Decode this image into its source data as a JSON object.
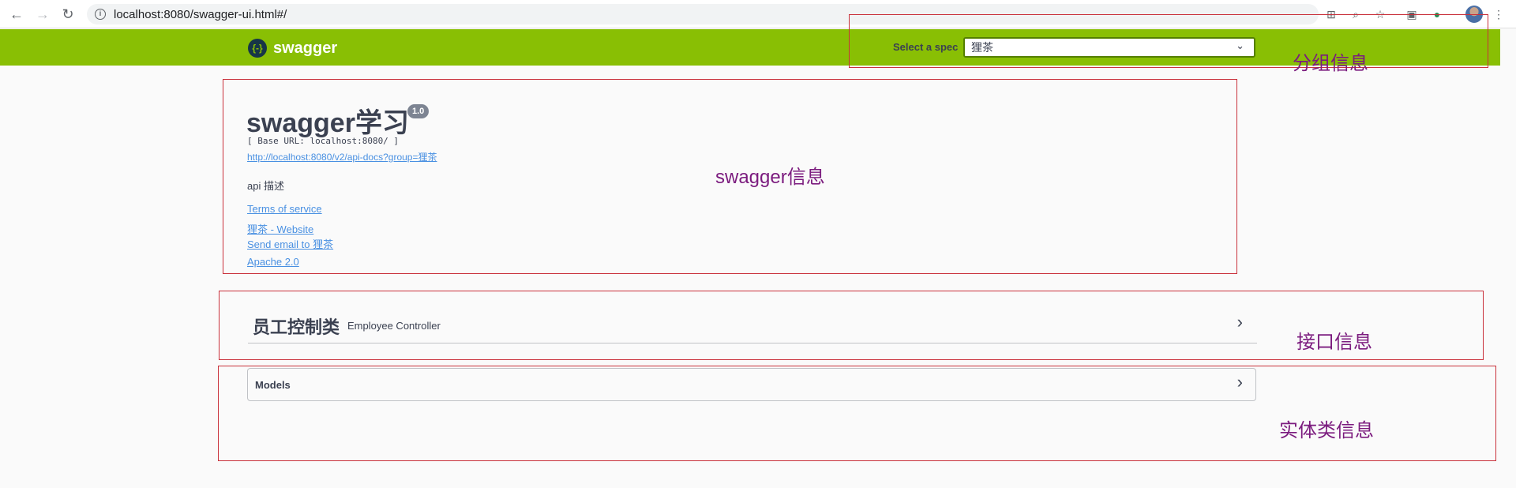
{
  "browser": {
    "back": "←",
    "forward": "→",
    "reload": "↻",
    "url": "localhost:8080/swagger-ui.html#/"
  },
  "swagger": {
    "logo_mark": "{-}",
    "logo_text": "swagger",
    "spec_label": "Select a spec",
    "spec_value": "狸茶",
    "spec_chevron": "⌄"
  },
  "info": {
    "title": "swagger学习",
    "version": "1.0",
    "base_url": "[ Base URL: localhost:8080/ ]",
    "api_docs_link": "http://localhost:8080/v2/api-docs?group=狸茶",
    "description": "api 描述",
    "terms": "Terms of service",
    "website": "狸茶 - Website",
    "email": "Send email to 狸茶",
    "license": "Apache 2.0"
  },
  "tags": [
    {
      "name": "员工控制类",
      "description": "Employee Controller",
      "chevron": "›"
    }
  ],
  "models": {
    "label": "Models",
    "chevron": "›"
  },
  "annotations": {
    "group": "分组信息",
    "swagger": "swagger信息",
    "api": "接口信息",
    "entity": "实体类信息"
  },
  "colors": {
    "topbar": "#89bf04",
    "link": "#4990e2",
    "annotation_border": "#c9303a",
    "annotation_text": "#7b1b7e"
  }
}
